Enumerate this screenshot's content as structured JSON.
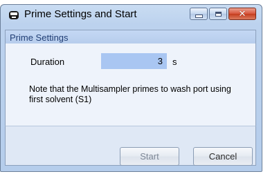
{
  "window": {
    "title": "Prime Settings and Start",
    "controls": [
      "minimize-icon",
      "maximize-icon",
      "close-icon"
    ]
  },
  "group": {
    "title": "Prime Settings",
    "duration_label": "Duration",
    "duration_value": "3",
    "duration_unit": "s",
    "note": "Note that the Multisampler primes to wash port using first solvent (S1)"
  },
  "buttons": {
    "start_label": "Start",
    "start_enabled": false,
    "cancel_label": "Cancel"
  },
  "colors": {
    "field_highlight": "#a9c6f2",
    "group_title": "#1f3d74",
    "close_button": "#c43c1e"
  }
}
